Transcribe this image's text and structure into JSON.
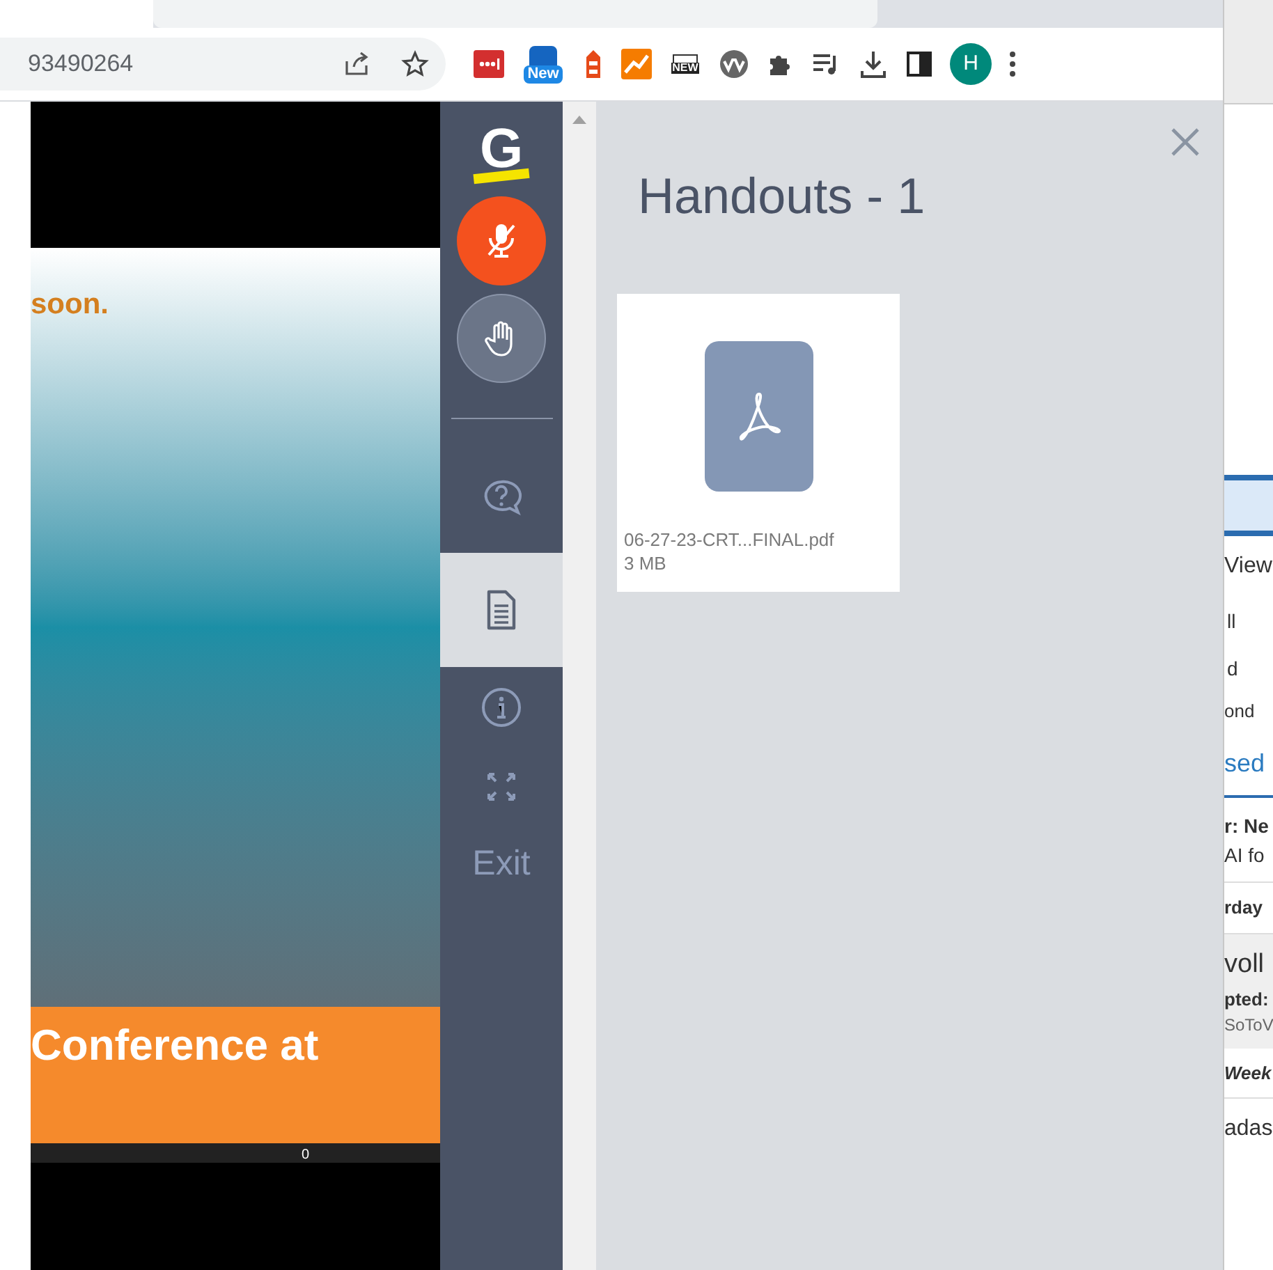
{
  "browser": {
    "address": "93490264",
    "extensions": [
      {
        "kind": "dots"
      },
      {
        "kind": "badge",
        "text": "New"
      },
      {
        "kind": "tower"
      },
      {
        "kind": "chart"
      },
      {
        "kind": "news",
        "text": "NEW"
      },
      {
        "kind": "wave"
      },
      {
        "kind": "puzzle"
      },
      {
        "kind": "playlist"
      },
      {
        "kind": "download"
      },
      {
        "kind": "sidepanel"
      }
    ],
    "avatar": "H"
  },
  "slide": {
    "top_text": "soon.",
    "banner_text": "Conference at",
    "footer_text": "0"
  },
  "sidebar": {
    "logo": "G",
    "items": [
      {
        "kind": "mic",
        "muted": true,
        "selected": false
      },
      {
        "kind": "hand",
        "selected": false
      },
      {
        "kind": "divider"
      },
      {
        "kind": "question",
        "selected": false
      },
      {
        "kind": "handouts",
        "selected": true
      },
      {
        "kind": "info",
        "selected": false
      },
      {
        "kind": "fullscreen",
        "selected": false
      },
      {
        "kind": "exit",
        "label": "Exit",
        "selected": false
      }
    ]
  },
  "panel": {
    "title": "Handouts - 1",
    "files": [
      {
        "name": "06-27-23-CRT...FINAL.pdf",
        "size": "3 MB"
      }
    ]
  },
  "background_window": {
    "texts": [
      "View",
      "ll",
      "d",
      "ond",
      "sed",
      "r: Ne",
      "AI fo",
      "rday",
      "voll",
      "pted:",
      "SoToV",
      "Week",
      "adas"
    ]
  }
}
